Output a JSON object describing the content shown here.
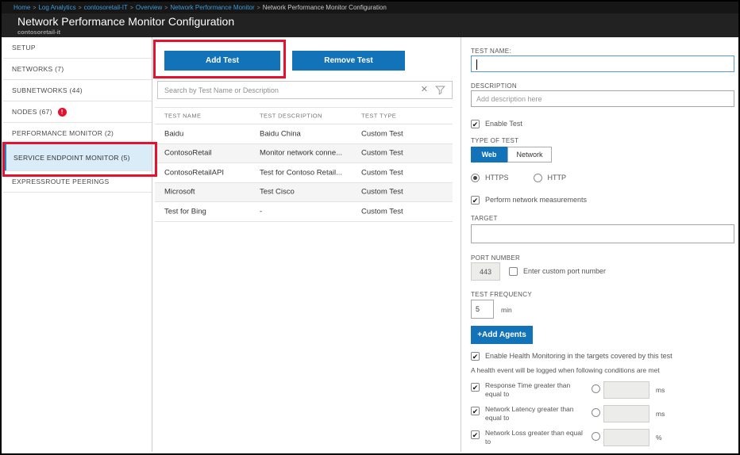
{
  "breadcrumb": {
    "separator": ">",
    "items": [
      "Home",
      "Log Analytics",
      "contosoretail-IT",
      "Overview",
      "Network Performance Monitor",
      "Network Performance Monitor Configuration"
    ]
  },
  "header": {
    "title": "Network Performance Monitor Configuration",
    "subtitle": "contosoretail-it"
  },
  "sidebar": {
    "items": [
      {
        "label": "SETUP"
      },
      {
        "label": "NETWORKS (7)"
      },
      {
        "label": "SUBNETWORKS (44)"
      },
      {
        "label": "NODES (67)",
        "badge": "!"
      },
      {
        "label": "PERFORMANCE MONITOR (2)"
      },
      {
        "label": "SERVICE ENDPOINT MONITOR (5)",
        "selected": true
      },
      {
        "label": "EXPRESSROUTE PEERINGS"
      }
    ]
  },
  "toolbar": {
    "add_test_label": "Add Test",
    "remove_test_label": "Remove Test"
  },
  "search": {
    "placeholder": "Search by Test Name or Description",
    "clear_icon": "✕"
  },
  "table": {
    "headers": [
      "TEST NAME",
      "TEST DESCRIPTION",
      "TEST TYPE"
    ],
    "rows": [
      [
        "Baidu",
        "Baidu China",
        "Custom Test"
      ],
      [
        "ContosoRetail",
        "Monitor network conne...",
        "Custom Test"
      ],
      [
        "ContosoRetailAPI",
        "Test for Contoso Retail...",
        "Custom Test"
      ],
      [
        "Microsoft",
        "Test Cisco",
        "Custom Test"
      ],
      [
        "Test for Bing",
        "-",
        "Custom Test"
      ]
    ]
  },
  "form": {
    "test_name_label": "TEST NAME:",
    "test_name_value": "",
    "description_label": "DESCRIPTION",
    "description_placeholder": "Add description here",
    "enable_test_label": "Enable Test",
    "type_of_test_label": "TYPE OF TEST",
    "type_web_label": "Web",
    "type_network_label": "Network",
    "protocol_https_label": "HTTPS",
    "protocol_http_label": "HTTP",
    "perform_network_label": "Perform network measurements",
    "target_label": "TARGET",
    "target_value": "",
    "port_number_label": "PORT NUMBER",
    "port_value": "443",
    "custom_port_label": "Enter custom port number",
    "test_frequency_label": "TEST FREQUENCY",
    "frequency_value": "5",
    "frequency_unit": "min",
    "add_agents_label": "+Add Agents",
    "health_monitoring_label": "Enable Health Monitoring in the targets covered by this test",
    "health_event_text": "A health event will be logged when following conditions are met",
    "check_glyph": "✔",
    "conditions": [
      {
        "label": "Response Time greater than equal to",
        "unit": "ms"
      },
      {
        "label": "Network Latency greater than equal to",
        "unit": "ms"
      },
      {
        "label": "Network Loss greater than equal to",
        "unit": "%"
      }
    ]
  },
  "colors": {
    "accent_blue": "#1373b9",
    "annotation_red": "#e8112d",
    "selected_item_bg": "#d9ecf8",
    "selected_item_border": "#1e87c8",
    "breadcrumb_link": "#3e9bd8",
    "header_bg": "#222222"
  }
}
